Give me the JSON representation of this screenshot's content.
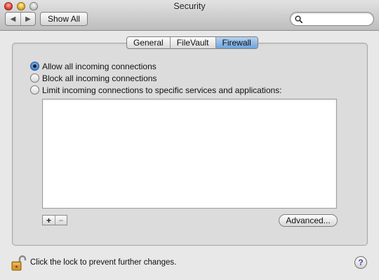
{
  "window": {
    "title": "Security"
  },
  "toolbar": {
    "show_all_label": "Show All",
    "search": {
      "placeholder": "",
      "value": ""
    },
    "icons": {
      "back": "back-icon",
      "forward": "forward-icon",
      "search": "search-icon"
    }
  },
  "tabs": [
    {
      "label": "General",
      "selected": false
    },
    {
      "label": "FileVault",
      "selected": false
    },
    {
      "label": "Firewall",
      "selected": true
    }
  ],
  "firewall": {
    "options": [
      {
        "label": "Allow all incoming connections",
        "selected": true
      },
      {
        "label": "Block all incoming connections",
        "selected": false
      },
      {
        "label": "Limit incoming connections to specific services and applications:",
        "selected": false
      }
    ],
    "add_label": "+",
    "remove_label": "−",
    "advanced_label": "Advanced..."
  },
  "footer": {
    "lock_text": "Click the lock to prevent further changes.",
    "help_label": "?"
  },
  "colors": {
    "selected_tab": "#6ea2dd",
    "radio_on": "#3e7fd0",
    "help_glyph": "#5a3aa8"
  }
}
